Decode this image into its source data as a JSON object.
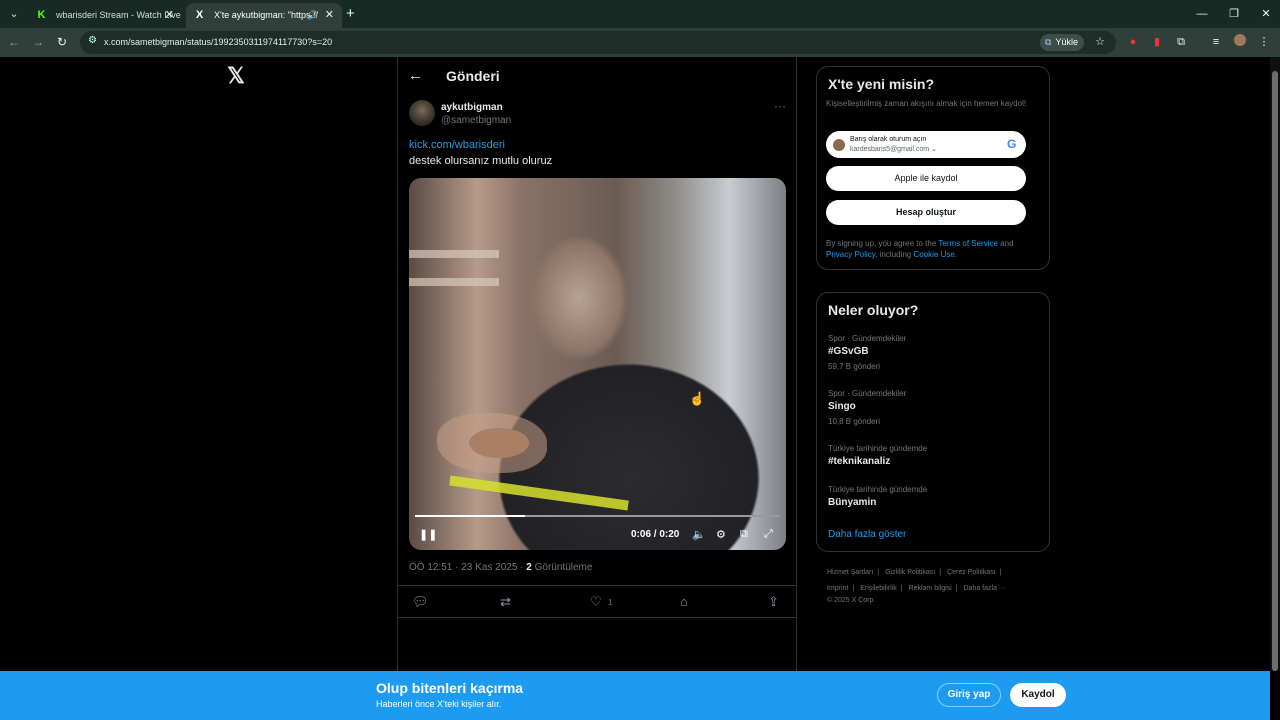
{
  "browser": {
    "tabs": [
      {
        "title": "wbarisderi Stream - Watch Live",
        "favicon": "K"
      },
      {
        "title": "X'te aykutbigman: \"https://",
        "favicon": "X"
      }
    ],
    "url": "x.com/sametbigman/status/1992350311974117730?s=20",
    "install_label": "Yükle"
  },
  "header": {
    "title": "Gönderi"
  },
  "post": {
    "author_name": "aykutbigman",
    "author_handle": "@sametbigman",
    "link": "kick.com/wbarisderi",
    "text": "destek olursanız mutlu oluruz",
    "video": {
      "time": "0:06 / 0:20",
      "progress": 0.3
    },
    "timestamp": "ÖÖ 12:51 · 23 Kas 2025 · ",
    "views_count": "2",
    "views_label": " Görüntüleme",
    "like_count": "1"
  },
  "signup": {
    "title": "X'te yeni misin?",
    "subtitle": "Kişiselleştirilmiş zaman akışını almak için hemen kaydol!",
    "google_line1": "Barış olarak oturum açın",
    "google_line2": "kardesbaris5@gmail.com ⌄",
    "apple_label": "Apple ile kaydol",
    "create_label": "Hesap oluştur",
    "legal_prefix": "By signing up, you agree to the ",
    "terms": "Terms of Service",
    "and": " and ",
    "privacy": "Privacy Policy",
    "including": ", including ",
    "cookie": "Cookie Use",
    "period": "."
  },
  "trends": {
    "title": "Neler oluyor?",
    "items": [
      {
        "context": "Spor · Gündemdekiler",
        "name": "#GSvGB",
        "count": "59,7 B gönderi"
      },
      {
        "context": "Spor · Gündemdekiler",
        "name": "Singo",
        "count": "10,8 B gönderi"
      },
      {
        "context": "Türkiye tarihinde gündemde",
        "name": "#teknikanaliz",
        "count": ""
      },
      {
        "context": "Türkiye tarihinde gündemde",
        "name": "Bünyamin",
        "count": ""
      }
    ],
    "show_more": "Daha fazla göster"
  },
  "footer": {
    "links": [
      "Hizmet Şartları",
      "|",
      "Gizlilik Politikası",
      "|",
      "Çerez Politikası",
      "|",
      "Imprint",
      "|",
      "Erişilebilirlik",
      "|",
      "Reklam bilgisi",
      "|",
      "Daha fazla ···"
    ],
    "copyright": "© 2025 X Corp."
  },
  "banner": {
    "title": "Olup bitenleri kaçırma",
    "subtitle": "Haberleri önce X'teki kişiler alır.",
    "login": "Giriş yap",
    "signup": "Kaydol"
  }
}
